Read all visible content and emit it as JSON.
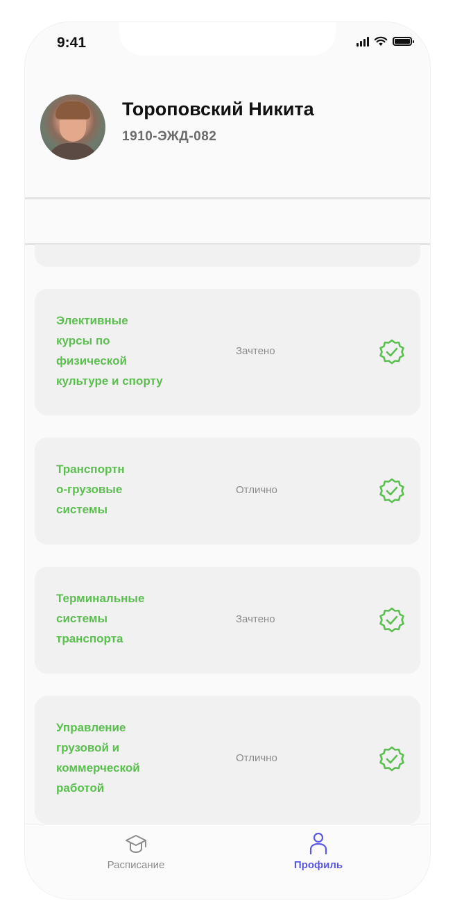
{
  "status_bar": {
    "time": "9:41"
  },
  "profile": {
    "name": "Тороповский Никита",
    "group": "1910-ЭЖД-082"
  },
  "grades": [
    {
      "subject": "Элективные курсы по физической культуре и спорту",
      "lines": [
        "Элективные",
        "курсы по",
        "физической",
        "культуре и спорту"
      ],
      "result": "Зачтено",
      "icon": "check-badge-icon"
    },
    {
      "subject": "Транспортно-грузовые системы",
      "lines": [
        "Транспортн",
        "о-грузовые",
        "системы"
      ],
      "result": "Отлично",
      "icon": "check-badge-icon"
    },
    {
      "subject": "Терминальные системы транспорта",
      "lines": [
        "Терминальные",
        "системы",
        "транспорта"
      ],
      "result": "Зачтено",
      "icon": "check-badge-icon"
    },
    {
      "subject": "Управление грузовой и коммерческой работой",
      "lines": [
        "Управление",
        "грузовой и",
        "коммерческой",
        "работой"
      ],
      "result": "Отлично",
      "icon": "check-badge-icon"
    }
  ],
  "tabs": [
    {
      "label": "Расписание",
      "icon": "graduation-cap-icon",
      "active": false
    },
    {
      "label": "Профиль",
      "icon": "user-icon",
      "active": true
    }
  ],
  "colors": {
    "accent_green": "#5bbf4f",
    "accent_purple": "#5b57e6",
    "card_bg": "#f1f1f1"
  }
}
